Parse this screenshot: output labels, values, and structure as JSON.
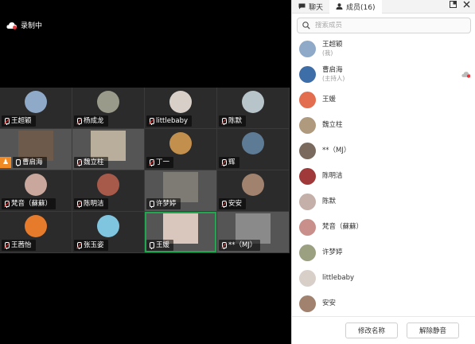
{
  "recording": {
    "label": "录制中",
    "icon": "recording-cloud-icon"
  },
  "tabs": [
    {
      "label": "聊天",
      "icon": "chat-icon"
    },
    {
      "label": "成员(16)",
      "icon": "person-icon"
    }
  ],
  "search": {
    "placeholder": "搜索成员"
  },
  "tiles": [
    {
      "name": "王超颖",
      "muted": true,
      "kind": "avatar",
      "color": "#8fa9c8"
    },
    {
      "name": "杨成龙",
      "muted": true,
      "kind": "avatar",
      "color": "#9a9a8a"
    },
    {
      "name": "littlebaby",
      "muted": true,
      "kind": "avatar",
      "color": "#d8d0c8"
    },
    {
      "name": "陈默",
      "muted": true,
      "kind": "avatar",
      "color": "#b7c4c9"
    },
    {
      "name": "曹启海",
      "muted": false,
      "kind": "video",
      "color": "#6e5a4a",
      "host": true
    },
    {
      "name": "魏立柱",
      "muted": true,
      "kind": "video",
      "color": "#b9ad9c"
    },
    {
      "name": "丁一",
      "muted": true,
      "kind": "avatar",
      "color": "#c38f4d"
    },
    {
      "name": "辉",
      "muted": true,
      "kind": "avatar",
      "color": "#5d7b94"
    },
    {
      "name": "梵音（蘇蘇）",
      "muted": true,
      "kind": "avatar",
      "color": "#c9a79c"
    },
    {
      "name": "陈明洁",
      "muted": true,
      "kind": "avatar",
      "color": "#a85a4a"
    },
    {
      "name": "许梦婷",
      "muted": false,
      "kind": "video",
      "color": "#7d7b74"
    },
    {
      "name": "安安",
      "muted": true,
      "kind": "avatar",
      "color": "#a0826e"
    },
    {
      "name": "王茜怡",
      "muted": true,
      "kind": "avatar",
      "color": "#e77b2c"
    },
    {
      "name": "张玉姿",
      "muted": true,
      "kind": "avatar",
      "color": "#7fc5e0"
    },
    {
      "name": "王媛",
      "muted": false,
      "kind": "video",
      "color": "#d9c7bd",
      "active": true
    },
    {
      "name": "**（MJ）",
      "muted": true,
      "kind": "video",
      "color": "#8a8a8a"
    }
  ],
  "members": [
    {
      "name": "王超颖",
      "role": "(我)",
      "color": "#8fa9c8"
    },
    {
      "name": "曹启海",
      "role": "(主持人)",
      "color": "#3d6ea8",
      "recording": true
    },
    {
      "name": "王媛",
      "role": "",
      "color": "#e26d4f"
    },
    {
      "name": "魏立柱",
      "role": "",
      "color": "#b09a7e"
    },
    {
      "name": "**（MJ）",
      "role": "",
      "color": "#7a6a5e"
    },
    {
      "name": "陈明洁",
      "role": "",
      "color": "#a03a3a"
    },
    {
      "name": "陈默",
      "role": "",
      "color": "#c4b0a8"
    },
    {
      "name": "梵音（蘇蘇）",
      "role": "",
      "color": "#c98f8a"
    },
    {
      "name": "许梦婷",
      "role": "",
      "color": "#9aa080"
    },
    {
      "name": "littlebaby",
      "role": "",
      "color": "#d8d0c8"
    },
    {
      "name": "安安",
      "role": "",
      "color": "#a0826e"
    }
  ],
  "footer": {
    "rename_label": "修改名称",
    "unmute_label": "解除静音"
  }
}
